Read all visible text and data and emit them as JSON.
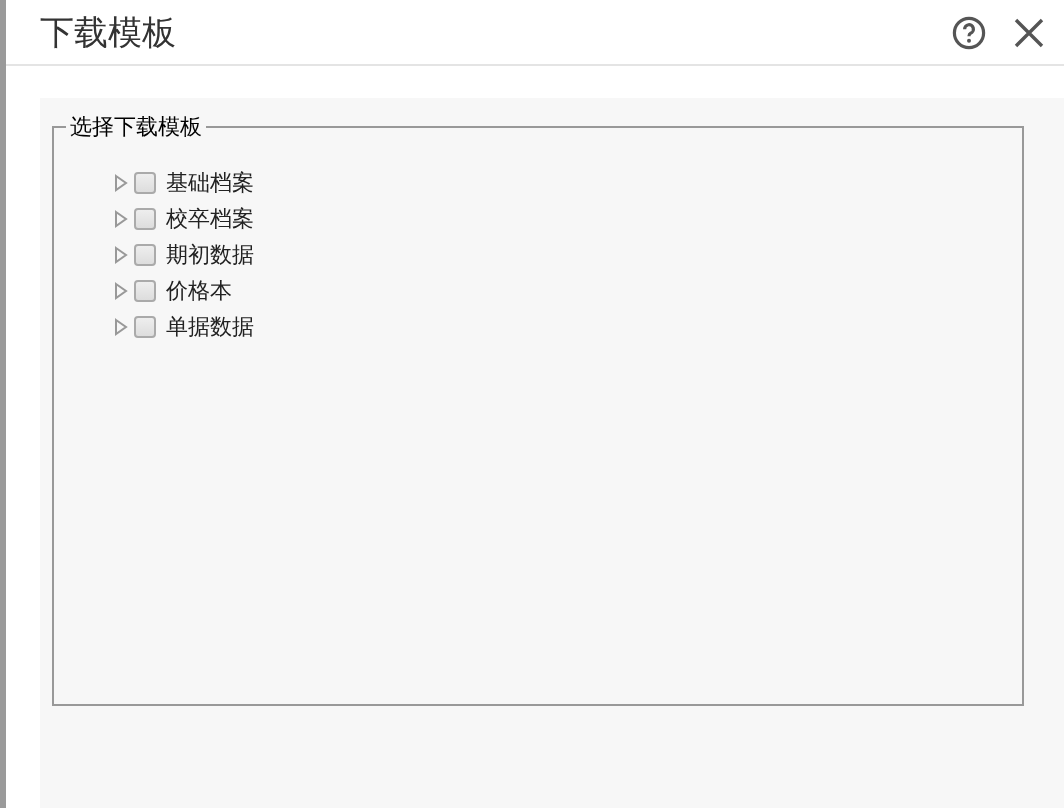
{
  "dialog": {
    "title": "下载模板"
  },
  "fieldset": {
    "legend": "选择下载模板",
    "items": [
      {
        "label": "基础档案",
        "expanded": false,
        "checked": false
      },
      {
        "label": "校卒档案",
        "expanded": false,
        "checked": false
      },
      {
        "label": "期初数据",
        "expanded": false,
        "checked": false
      },
      {
        "label": "价格本",
        "expanded": false,
        "checked": false
      },
      {
        "label": "单据数据",
        "expanded": false,
        "checked": false
      }
    ]
  }
}
